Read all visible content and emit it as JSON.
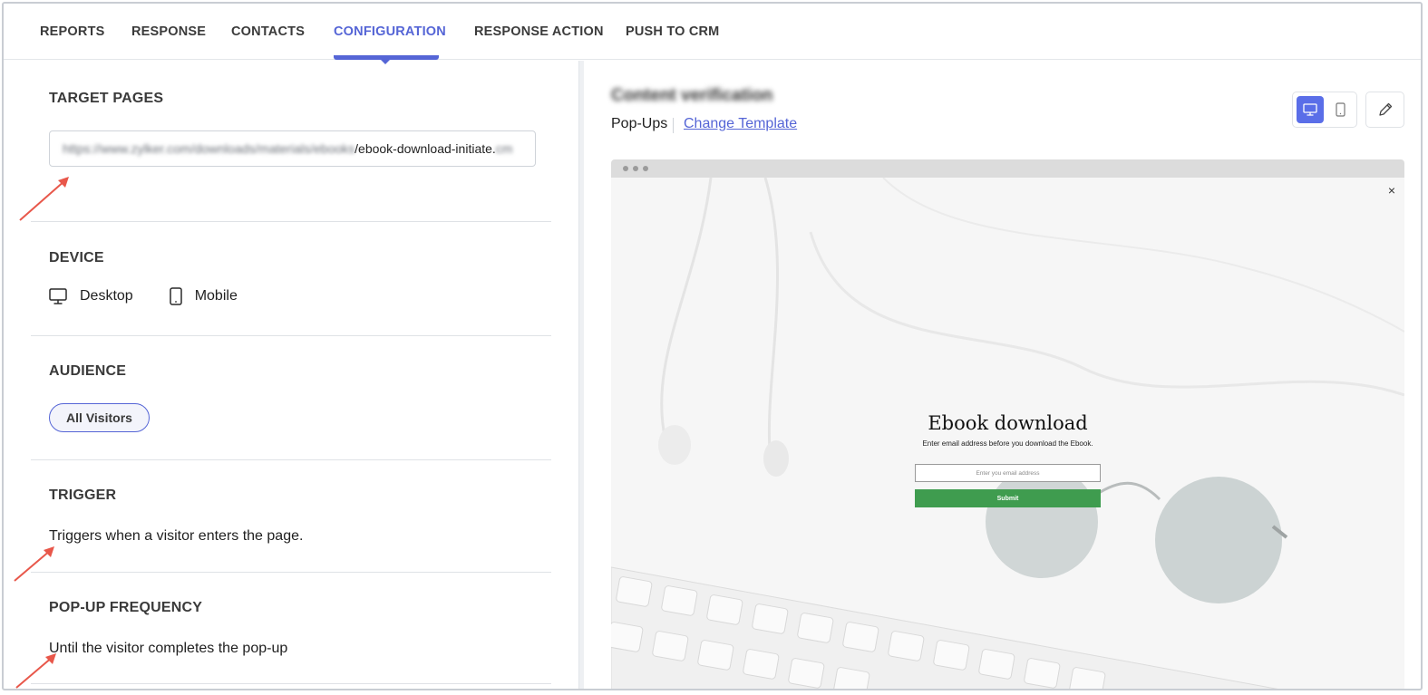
{
  "nav": {
    "tabs": [
      {
        "label": "REPORTS"
      },
      {
        "label": "RESPONSE"
      },
      {
        "label": "CONTACTS"
      },
      {
        "label": "CONFIGURATION"
      },
      {
        "label": "RESPONSE ACTION"
      },
      {
        "label": "PUSH TO CRM"
      }
    ],
    "active_tab": "CONFIGURATION"
  },
  "config": {
    "target_pages": {
      "title": "TARGET PAGES",
      "url_blurred": "https://www.zylker.com/downloads/materials/ebooks",
      "url_visible": "/ebook-download-initiate.",
      "url_tail_blurred": "cm"
    },
    "device": {
      "title": "DEVICE",
      "options": [
        {
          "label": "Desktop",
          "icon": "desktop-icon"
        },
        {
          "label": "Mobile",
          "icon": "mobile-icon"
        }
      ]
    },
    "audience": {
      "title": "AUDIENCE",
      "value": "All Visitors"
    },
    "trigger": {
      "title": "TRIGGER",
      "value": "Triggers when a visitor enters the page."
    },
    "frequency": {
      "title": "POP-UP FREQUENCY",
      "value": "Until the visitor completes the pop-up"
    }
  },
  "preview": {
    "template_name": "Content verification",
    "template_type": "Pop-Ups",
    "change_template": "Change Template",
    "close_symbol": "×",
    "popup": {
      "title": "Ebook download",
      "subtitle": "Enter email address before you download the Ebook.",
      "input_placeholder": "Enter you email address",
      "submit_label": "Submit"
    }
  },
  "colors": {
    "accent": "#5565d6",
    "annotation_arrow": "#e8574a",
    "submit_green": "#3f9c4f"
  }
}
